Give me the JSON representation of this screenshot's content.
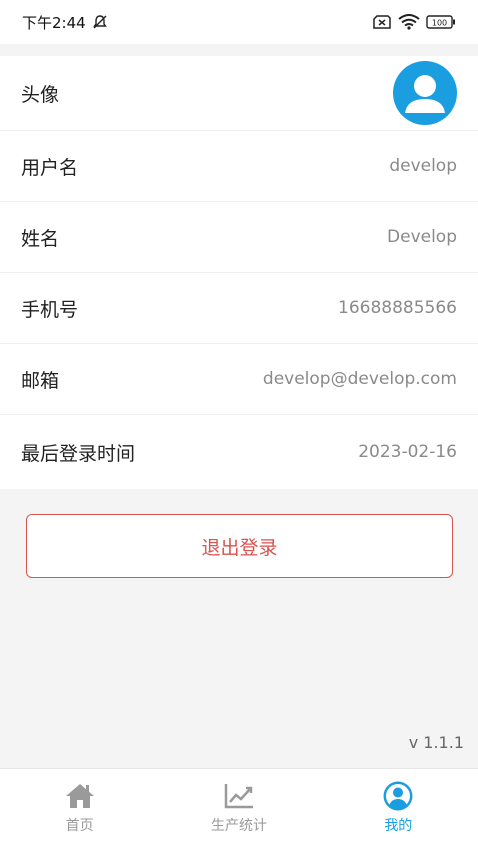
{
  "status_bar": {
    "time": "下午2:44",
    "battery": "100"
  },
  "profile": {
    "avatar_label": "头像",
    "rows": [
      {
        "label": "用户名",
        "value": "develop"
      },
      {
        "label": "姓名",
        "value": "Develop"
      },
      {
        "label": "手机号",
        "value": "16688885566"
      },
      {
        "label": "邮箱",
        "value": "develop@develop.com"
      },
      {
        "label": "最后登录时间",
        "value": "2023-02-16"
      }
    ]
  },
  "logout_label": "退出登录",
  "version": "v 1.1.1",
  "tabs": [
    {
      "label": "首页",
      "icon": "home-icon",
      "active": false
    },
    {
      "label": "生产统计",
      "icon": "chart-icon",
      "active": false
    },
    {
      "label": "我的",
      "icon": "user-icon",
      "active": true
    }
  ],
  "colors": {
    "accent": "#1a9ee0",
    "danger": "#d9534f",
    "inactive": "#9a9a9a"
  }
}
